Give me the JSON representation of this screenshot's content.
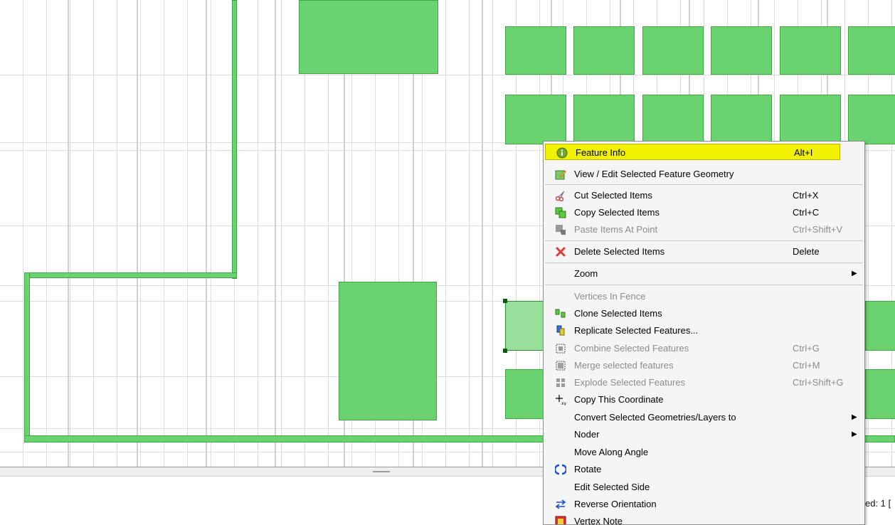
{
  "colors": {
    "feature_fill": "#6ad26e",
    "feature_border": "#3fa545",
    "selected_fill": "#98df9a",
    "highlight": "#f2f200",
    "disabled_text": "#8c8c8c"
  },
  "context_menu": {
    "items": [
      {
        "label": "Feature Info",
        "shortcut": "Alt+I",
        "icon": "info-icon",
        "highlighted": true
      },
      {
        "label": "View / Edit Selected Feature Geometry",
        "shortcut": "",
        "icon": "edit-geometry-icon"
      },
      {
        "label": "Cut Selected Items",
        "shortcut": "Ctrl+X",
        "icon": "scissors-icon"
      },
      {
        "label": "Copy Selected Items",
        "shortcut": "Ctrl+C",
        "icon": "copy-icon"
      },
      {
        "label": "Paste Items At Point",
        "shortcut": "Ctrl+Shift+V",
        "icon": "paste-icon",
        "disabled": true
      },
      {
        "label": "Delete Selected Items",
        "shortcut": "Delete",
        "icon": "delete-icon"
      },
      {
        "label": "Zoom",
        "shortcut": "",
        "icon": "",
        "submenu": true
      },
      {
        "label": "Vertices In Fence",
        "shortcut": "",
        "icon": "",
        "disabled": true
      },
      {
        "label": "Clone Selected Items",
        "shortcut": "",
        "icon": "clone-icon"
      },
      {
        "label": "Replicate Selected Features...",
        "shortcut": "",
        "icon": "replicate-icon"
      },
      {
        "label": "Combine Selected Features",
        "shortcut": "Ctrl+G",
        "icon": "combine-icon",
        "disabled": true
      },
      {
        "label": "Merge selected features",
        "shortcut": "Ctrl+M",
        "icon": "merge-icon",
        "disabled": true
      },
      {
        "label": "Explode Selected Features",
        "shortcut": "Ctrl+Shift+G",
        "icon": "explode-icon",
        "disabled": true
      },
      {
        "label": "Copy This Coordinate",
        "shortcut": "",
        "icon": "coordinate-icon"
      },
      {
        "label": "Convert Selected Geometries/Layers to",
        "shortcut": "",
        "icon": "",
        "submenu": true
      },
      {
        "label": "Noder",
        "shortcut": "",
        "icon": "",
        "submenu": true
      },
      {
        "label": "Move Along Angle",
        "shortcut": "",
        "icon": ""
      },
      {
        "label": "Rotate",
        "shortcut": "",
        "icon": "rotate-icon"
      },
      {
        "label": "Edit Selected Side",
        "shortcut": "",
        "icon": ""
      },
      {
        "label": "Reverse Orientation",
        "shortcut": "",
        "icon": "reverse-icon"
      },
      {
        "label": "Vertex Note",
        "shortcut": "",
        "icon": "vertex-note-icon"
      }
    ],
    "submenu_arrow": "▶"
  },
  "status_bar": {
    "selected_text": "ed: 1 ["
  }
}
